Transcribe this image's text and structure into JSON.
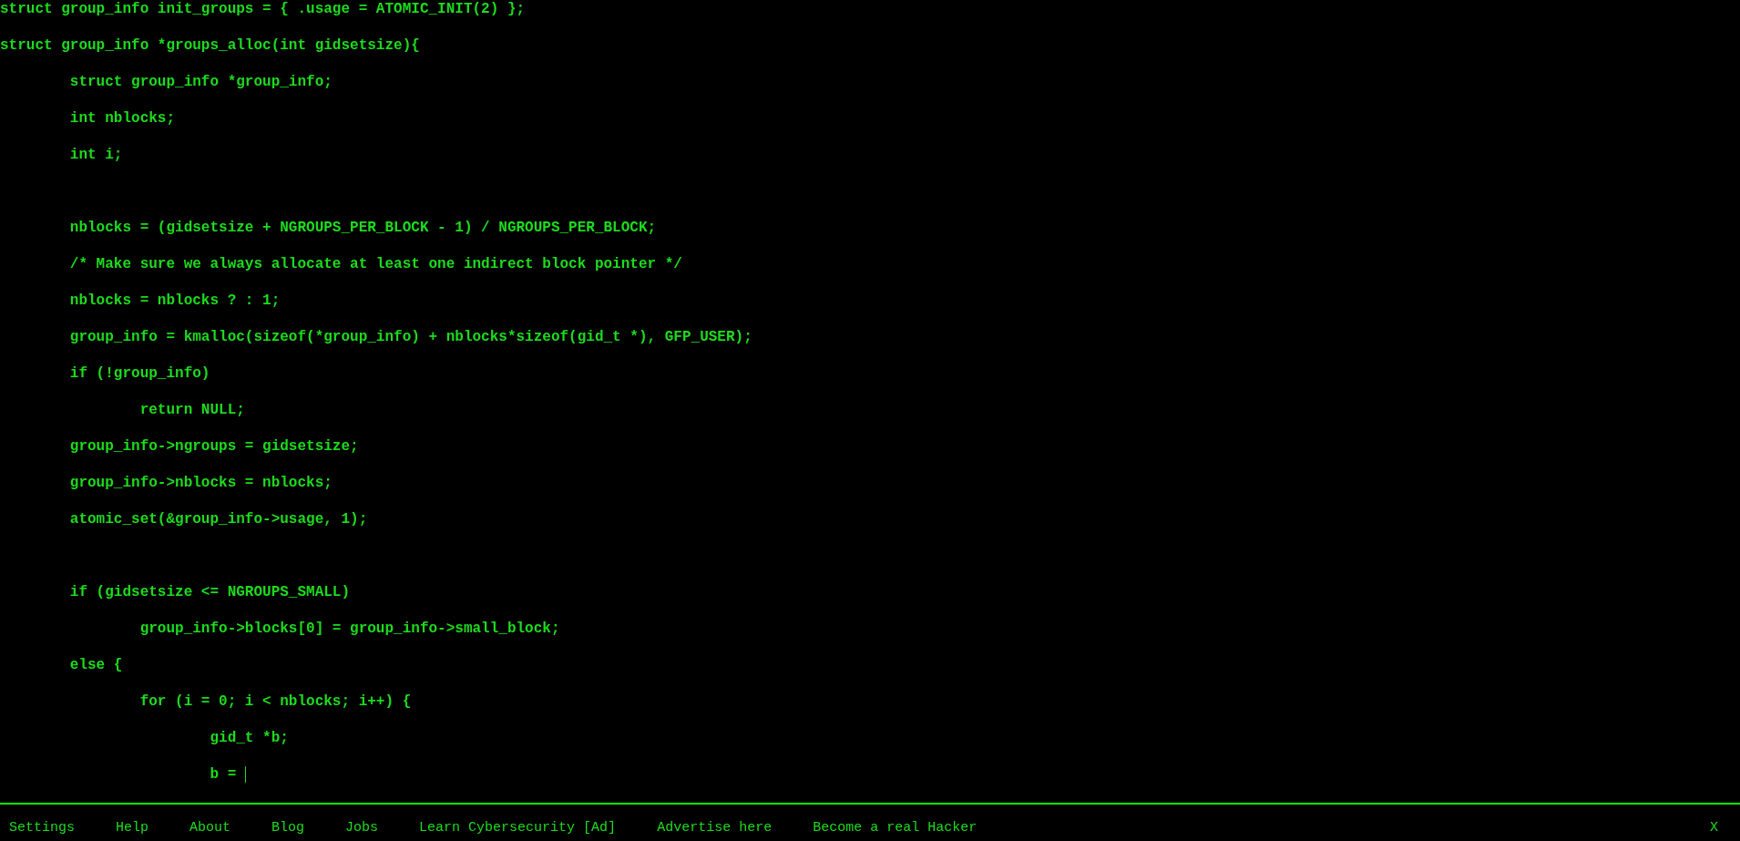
{
  "code": {
    "cursor": true,
    "blocks": [
      {
        "lines": [
          "struct group_info init_groups = { .usage = ATOMIC_INIT(2) };",
          "struct group_info *groups_alloc(int gidsetsize){",
          "\tstruct group_info *group_info;",
          "\tint nblocks;",
          "\tint i;"
        ]
      },
      {
        "lines": [
          "\tnblocks = (gidsetsize + NGROUPS_PER_BLOCK - 1) / NGROUPS_PER_BLOCK;",
          "\t/* Make sure we always allocate at least one indirect block pointer */",
          "\tnblocks = nblocks ? : 1;",
          "\tgroup_info = kmalloc(sizeof(*group_info) + nblocks*sizeof(gid_t *), GFP_USER);",
          "\tif (!group_info)",
          "\t\treturn NULL;",
          "\tgroup_info->ngroups = gidsetsize;",
          "\tgroup_info->nblocks = nblocks;",
          "\tatomic_set(&group_info->usage, 1);"
        ]
      },
      {
        "lines": [
          "\tif (gidsetsize <= NGROUPS_SMALL)",
          "\t\tgroup_info->blocks[0] = group_info->small_block;",
          "\telse {",
          "\t\tfor (i = 0; i < nblocks; i++) {",
          "\t\t\tgid_t *b;",
          "\t\t\tb = "
        ]
      }
    ]
  },
  "menu": {
    "items": [
      "Settings",
      "Help",
      "About",
      "Blog",
      "Jobs",
      "Learn Cybersecurity [Ad]",
      "Advertise here",
      "Become a real Hacker"
    ],
    "close": "X"
  }
}
